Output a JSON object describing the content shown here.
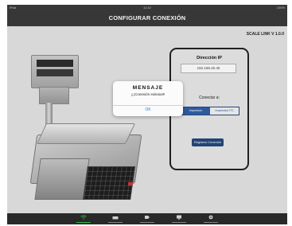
{
  "status_bar": {
    "carrier": "iPad",
    "time": "11:42",
    "battery": "100%"
  },
  "title": "CONFIGURAR CONEXIÓN",
  "version": "SCALE LINK V 1.0.0",
  "panel": {
    "ip_title": "Dirección IP",
    "ip_value": "192.168.45.45",
    "connect_label": "Conectar a:",
    "segments": [
      {
        "label": "Impresión",
        "active": true
      },
      {
        "label": "Impresión PC",
        "active": false
      }
    ],
    "register_button": "Registrar Conexión"
  },
  "modal": {
    "title": "MENSAJE",
    "message": "¡¡¡Conexión exitosa!!!",
    "ok": "OK"
  },
  "tab_bar": {
    "items": [
      {
        "icon": "wifi-icon",
        "active": true
      },
      {
        "icon": "scale-icon",
        "active": false
      },
      {
        "icon": "tag-icon",
        "active": false
      },
      {
        "icon": "monitor-icon",
        "active": false
      },
      {
        "icon": "gear-icon",
        "active": false
      }
    ]
  },
  "colors": {
    "accent_blue": "#2f5fa6",
    "active_tab": "#33c24d",
    "bars": "#3a3a3a"
  }
}
